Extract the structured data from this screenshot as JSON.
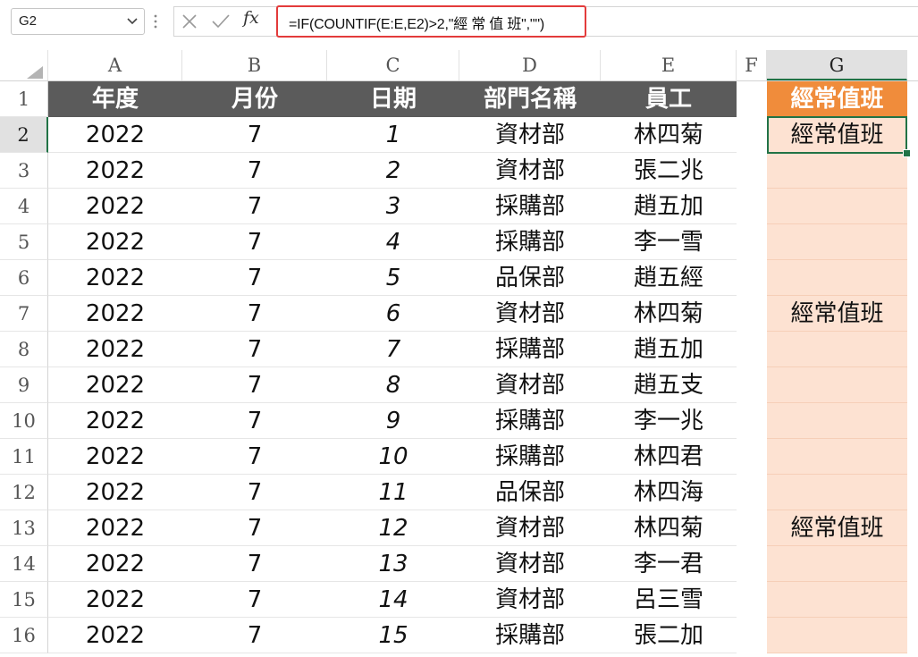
{
  "name_box": {
    "value": "G2"
  },
  "formula_bar": {
    "formula": "=IF(COUNTIF(E:E,E2)>2,\"經 常 值 班\",\"\")"
  },
  "icons": {
    "cancel": "x-icon",
    "enter": "check-icon",
    "fx": "fx-icon"
  },
  "fx_label": "fx",
  "columns": [
    "A",
    "B",
    "C",
    "D",
    "E",
    "F",
    "G"
  ],
  "selected_cell": "G2",
  "headers": {
    "A": "年度",
    "B": "月份",
    "C": "日期",
    "D": "部門名稱",
    "E": "員工",
    "G": "經常值班"
  },
  "rows": [
    {
      "row": "2",
      "year": "2022",
      "month": "7",
      "day": "1",
      "dept": "資材部",
      "emp": "林四菊",
      "flag": "經常值班"
    },
    {
      "row": "3",
      "year": "2022",
      "month": "7",
      "day": "2",
      "dept": "資材部",
      "emp": "張二兆",
      "flag": ""
    },
    {
      "row": "4",
      "year": "2022",
      "month": "7",
      "day": "3",
      "dept": "採購部",
      "emp": "趙五加",
      "flag": ""
    },
    {
      "row": "5",
      "year": "2022",
      "month": "7",
      "day": "4",
      "dept": "採購部",
      "emp": "李一雪",
      "flag": ""
    },
    {
      "row": "6",
      "year": "2022",
      "month": "7",
      "day": "5",
      "dept": "品保部",
      "emp": "趙五經",
      "flag": ""
    },
    {
      "row": "7",
      "year": "2022",
      "month": "7",
      "day": "6",
      "dept": "資材部",
      "emp": "林四菊",
      "flag": "經常值班"
    },
    {
      "row": "8",
      "year": "2022",
      "month": "7",
      "day": "7",
      "dept": "採購部",
      "emp": "趙五加",
      "flag": ""
    },
    {
      "row": "9",
      "year": "2022",
      "month": "7",
      "day": "8",
      "dept": "資材部",
      "emp": "趙五支",
      "flag": ""
    },
    {
      "row": "10",
      "year": "2022",
      "month": "7",
      "day": "9",
      "dept": "採購部",
      "emp": "李一兆",
      "flag": ""
    },
    {
      "row": "11",
      "year": "2022",
      "month": "7",
      "day": "10",
      "dept": "採購部",
      "emp": "林四君",
      "flag": ""
    },
    {
      "row": "12",
      "year": "2022",
      "month": "7",
      "day": "11",
      "dept": "品保部",
      "emp": "林四海",
      "flag": ""
    },
    {
      "row": "13",
      "year": "2022",
      "month": "7",
      "day": "12",
      "dept": "資材部",
      "emp": "林四菊",
      "flag": "經常值班"
    },
    {
      "row": "14",
      "year": "2022",
      "month": "7",
      "day": "13",
      "dept": "資材部",
      "emp": "李一君",
      "flag": ""
    },
    {
      "row": "15",
      "year": "2022",
      "month": "7",
      "day": "14",
      "dept": "資材部",
      "emp": "呂三雪",
      "flag": ""
    },
    {
      "row": "16",
      "year": "2022",
      "month": "7",
      "day": "15",
      "dept": "採購部",
      "emp": "張二加",
      "flag": ""
    }
  ],
  "colors": {
    "header_fill": "#5b5b5b",
    "flag_header_fill": "#f08c3b",
    "flag_column_fill": "#fde2d2",
    "formula_highlight": "#e33b3b",
    "selection": "#217346"
  }
}
